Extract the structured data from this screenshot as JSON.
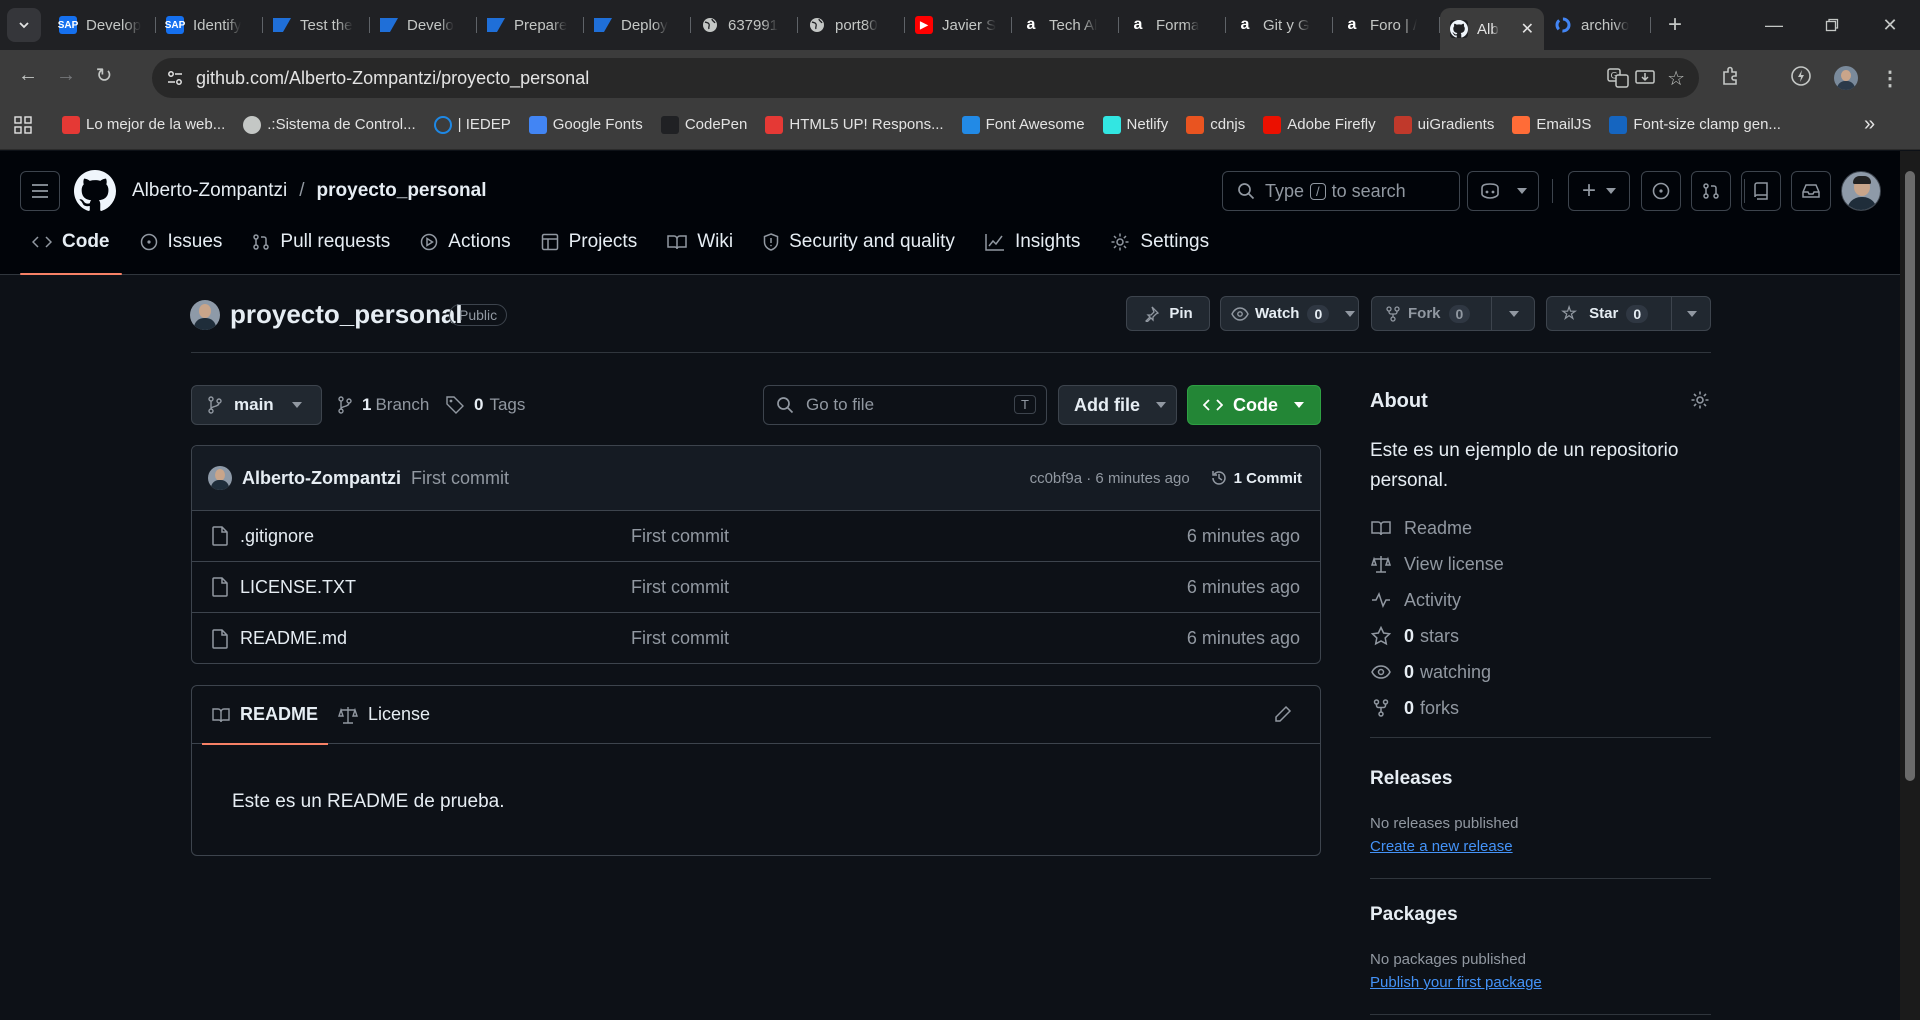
{
  "browser": {
    "tabs": [
      {
        "title": "Develop",
        "fav": "SAP",
        "color": "#1570ef",
        "icon": "sap-icon"
      },
      {
        "title": "Identify",
        "fav": "SAP",
        "color": "#1570ef",
        "icon": "sap-icon"
      },
      {
        "title": "Test the",
        "fav": "",
        "color": "#0a6ed1",
        "icon": "sap-flag-icon"
      },
      {
        "title": "Develo",
        "fav": "",
        "color": "#0a6ed1",
        "icon": "sap-flag-icon"
      },
      {
        "title": "Prepare",
        "fav": "",
        "color": "#0a6ed1",
        "icon": "sap-flag-icon"
      },
      {
        "title": "Deploy",
        "fav": "",
        "color": "#0a6ed1",
        "icon": "sap-flag-icon"
      },
      {
        "title": "637991",
        "fav": "",
        "color": "#5f6368",
        "icon": "globe-icon"
      },
      {
        "title": "port80",
        "fav": "",
        "color": "#5f6368",
        "icon": "globe-icon"
      },
      {
        "title": "Javier S",
        "fav": "▶",
        "color": "#ff0000",
        "icon": "youtube-icon"
      },
      {
        "title": "Tech Al",
        "fav": "a",
        "color": "#202124",
        "icon": "alura-icon"
      },
      {
        "title": "Forma",
        "fav": "a",
        "color": "#202124",
        "icon": "alura-icon"
      },
      {
        "title": "Git y G",
        "fav": "a",
        "color": "#202124",
        "icon": "alura-icon"
      },
      {
        "title": "Foro | /",
        "fav": "a",
        "color": "#202124",
        "icon": "alura-icon"
      },
      {
        "title": "Alb",
        "fav": "",
        "color": "#202124",
        "icon": "github-icon",
        "active": true
      },
      {
        "title": "archivo",
        "fav": "G",
        "color": "#202124",
        "icon": "google-icon"
      }
    ],
    "url": "github.com/Alberto-Zompantzi/proyecto_personal",
    "bookmarks": [
      {
        "label": "Lo mejor de la web...",
        "color": "#e53935",
        "icon": "bookmark-favicon"
      },
      {
        "label": ".:Sistema de Control...",
        "color": "#5f6368",
        "icon": "globe-icon"
      },
      {
        "label": "| IEDEP",
        "color": "#1e88e5",
        "icon": "circle-icon"
      },
      {
        "label": "Google Fonts",
        "color": "#4285f4",
        "icon": "google-fonts-icon"
      },
      {
        "label": "CodePen",
        "color": "#202124",
        "icon": "codepen-icon"
      },
      {
        "label": "HTML5 UP! Respons...",
        "color": "#e53935",
        "icon": "html5up-icon"
      },
      {
        "label": "Font Awesome",
        "color": "#228ae6",
        "icon": "font-awesome-icon"
      },
      {
        "label": "Netlify",
        "color": "#32e6e2",
        "icon": "netlify-icon"
      },
      {
        "label": "cdnjs",
        "color": "#e95420",
        "icon": "cdnjs-icon"
      },
      {
        "label": "Adobe Firefly",
        "color": "#eb1000",
        "icon": "adobe-icon"
      },
      {
        "label": "uiGradients",
        "color": "#c0392b",
        "icon": "uigradients-icon"
      },
      {
        "label": "EmailJS",
        "color": "#ff6c37",
        "icon": "emailjs-icon"
      },
      {
        "label": "Font-size clamp gen...",
        "color": "#1565c0",
        "icon": "fs-icon"
      }
    ]
  },
  "header": {
    "owner": "Alberto-Zompantzi",
    "separator": "/",
    "repo": "proyecto_personal",
    "search_placeholder_pre": "Type",
    "search_key": "/",
    "search_placeholder_post": "to search"
  },
  "repo_nav": [
    {
      "label": "Code",
      "icon": "code-icon",
      "selected": true
    },
    {
      "label": "Issues",
      "icon": "issue-icon"
    },
    {
      "label": "Pull requests",
      "icon": "pull-request-icon"
    },
    {
      "label": "Actions",
      "icon": "play-icon"
    },
    {
      "label": "Projects",
      "icon": "table-icon"
    },
    {
      "label": "Wiki",
      "icon": "book-icon"
    },
    {
      "label": "Security and quality",
      "icon": "shield-icon"
    },
    {
      "label": "Insights",
      "icon": "graph-icon"
    },
    {
      "label": "Settings",
      "icon": "gear-icon"
    }
  ],
  "repo": {
    "name": "proyecto_personal",
    "visibility": "Public",
    "pin": "Pin",
    "watch": "Watch",
    "watch_count": "0",
    "fork": "Fork",
    "fork_count": "0",
    "star": "Star",
    "star_count": "0"
  },
  "toolbar": {
    "branch": "main",
    "branches_count": "1",
    "branches_label": "Branch",
    "tags_count": "0",
    "tags_label": "Tags",
    "goto_placeholder": "Go to file",
    "goto_key": "T",
    "add_file": "Add file",
    "code": "Code"
  },
  "commit": {
    "author": "Alberto-Zompantzi",
    "message": "First commit",
    "hash_time": "cc0bf9a · 6 minutes ago",
    "count": "1 Commit"
  },
  "files": [
    {
      "name": ".gitignore",
      "message": "First commit",
      "time": "6 minutes ago"
    },
    {
      "name": "LICENSE.TXT",
      "message": "First commit",
      "time": "6 minutes ago"
    },
    {
      "name": "README.md",
      "message": "First commit",
      "time": "6 minutes ago"
    }
  ],
  "readme": {
    "tab_readme": "README",
    "tab_license": "License",
    "content": "Este es un README de prueba."
  },
  "about": {
    "title": "About",
    "description": "Este es un ejemplo de un repositorio personal.",
    "links": [
      {
        "label": "Readme",
        "icon": "book-icon"
      },
      {
        "label": "View license",
        "icon": "scale-icon"
      },
      {
        "label": "Activity",
        "icon": "pulse-icon"
      },
      {
        "count": "0",
        "label": "stars",
        "icon": "star-icon"
      },
      {
        "count": "0",
        "label": "watching",
        "icon": "eye-icon"
      },
      {
        "count": "0",
        "label": "forks",
        "icon": "fork-icon"
      }
    ]
  },
  "releases": {
    "title": "Releases",
    "empty": "No releases published",
    "link": "Create a new release"
  },
  "packages": {
    "title": "Packages",
    "empty": "No packages published",
    "link": "Publish your first package"
  },
  "colors": {
    "accent_green": "#238636",
    "tab_underline": "#f78166",
    "link": "#4493f8"
  }
}
